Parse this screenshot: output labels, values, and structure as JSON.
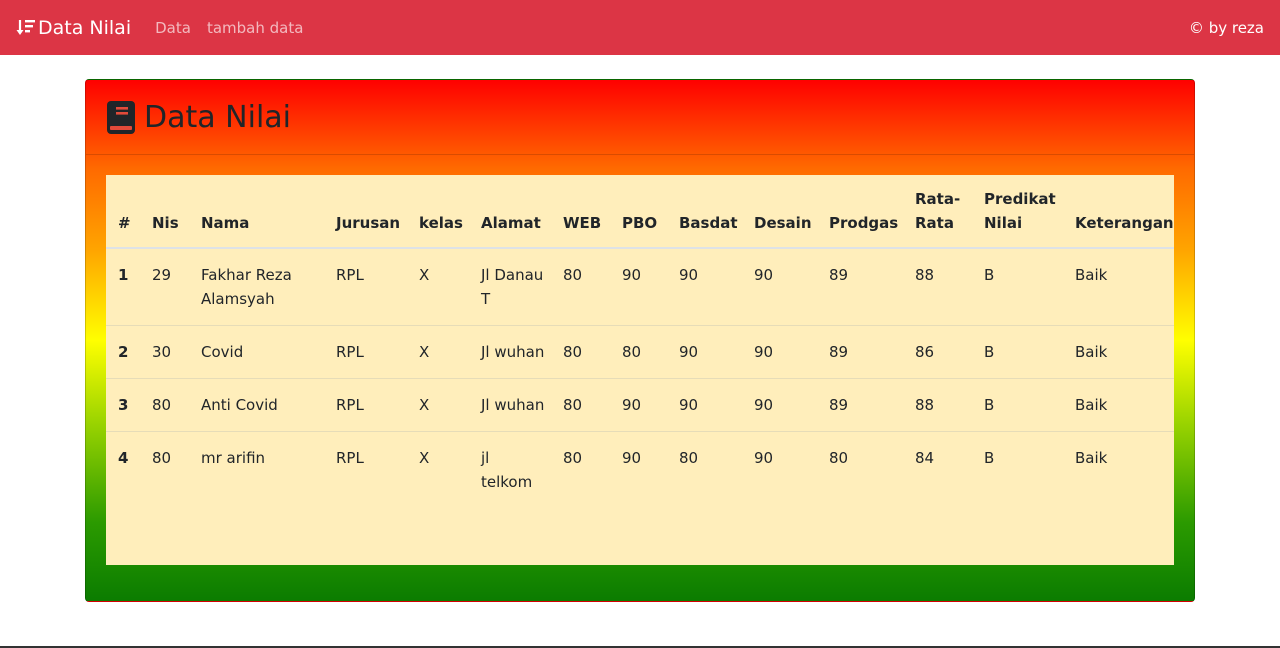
{
  "navbar": {
    "brand": "Data Nilai",
    "brand_icon": "sort-amount-down-icon",
    "links": [
      "Data",
      "tambah data"
    ],
    "credit": "© by reza",
    "background": "#dc3545"
  },
  "card": {
    "title": "Data Nilai",
    "title_icon": "book-icon"
  },
  "table": {
    "headers": [
      "#",
      "Nis",
      "Nama",
      "Jurusan",
      "kelas",
      "Alamat",
      "WEB",
      "PBO",
      "Basdat",
      "Desain",
      "Prodgas",
      "Rata-Rata",
      "Predikat Nilai",
      "Keterangan"
    ],
    "rows": [
      [
        "1",
        "29",
        "Fakhar Reza Alamsyah",
        "RPL",
        "X",
        "Jl Danau T",
        "80",
        "90",
        "90",
        "90",
        "89",
        "88",
        "B",
        "Baik"
      ],
      [
        "2",
        "30",
        "Covid",
        "RPL",
        "X",
        "Jl wuhan",
        "80",
        "80",
        "90",
        "90",
        "89",
        "86",
        "B",
        "Baik"
      ],
      [
        "3",
        "80",
        "Anti Covid",
        "RPL",
        "X",
        "Jl wuhan",
        "80",
        "90",
        "90",
        "90",
        "89",
        "88",
        "B",
        "Baik"
      ],
      [
        "4",
        "80",
        "mr arifin",
        "RPL",
        "X",
        "jl telkom",
        "80",
        "90",
        "80",
        "90",
        "80",
        "84",
        "B",
        "Baik"
      ]
    ]
  }
}
